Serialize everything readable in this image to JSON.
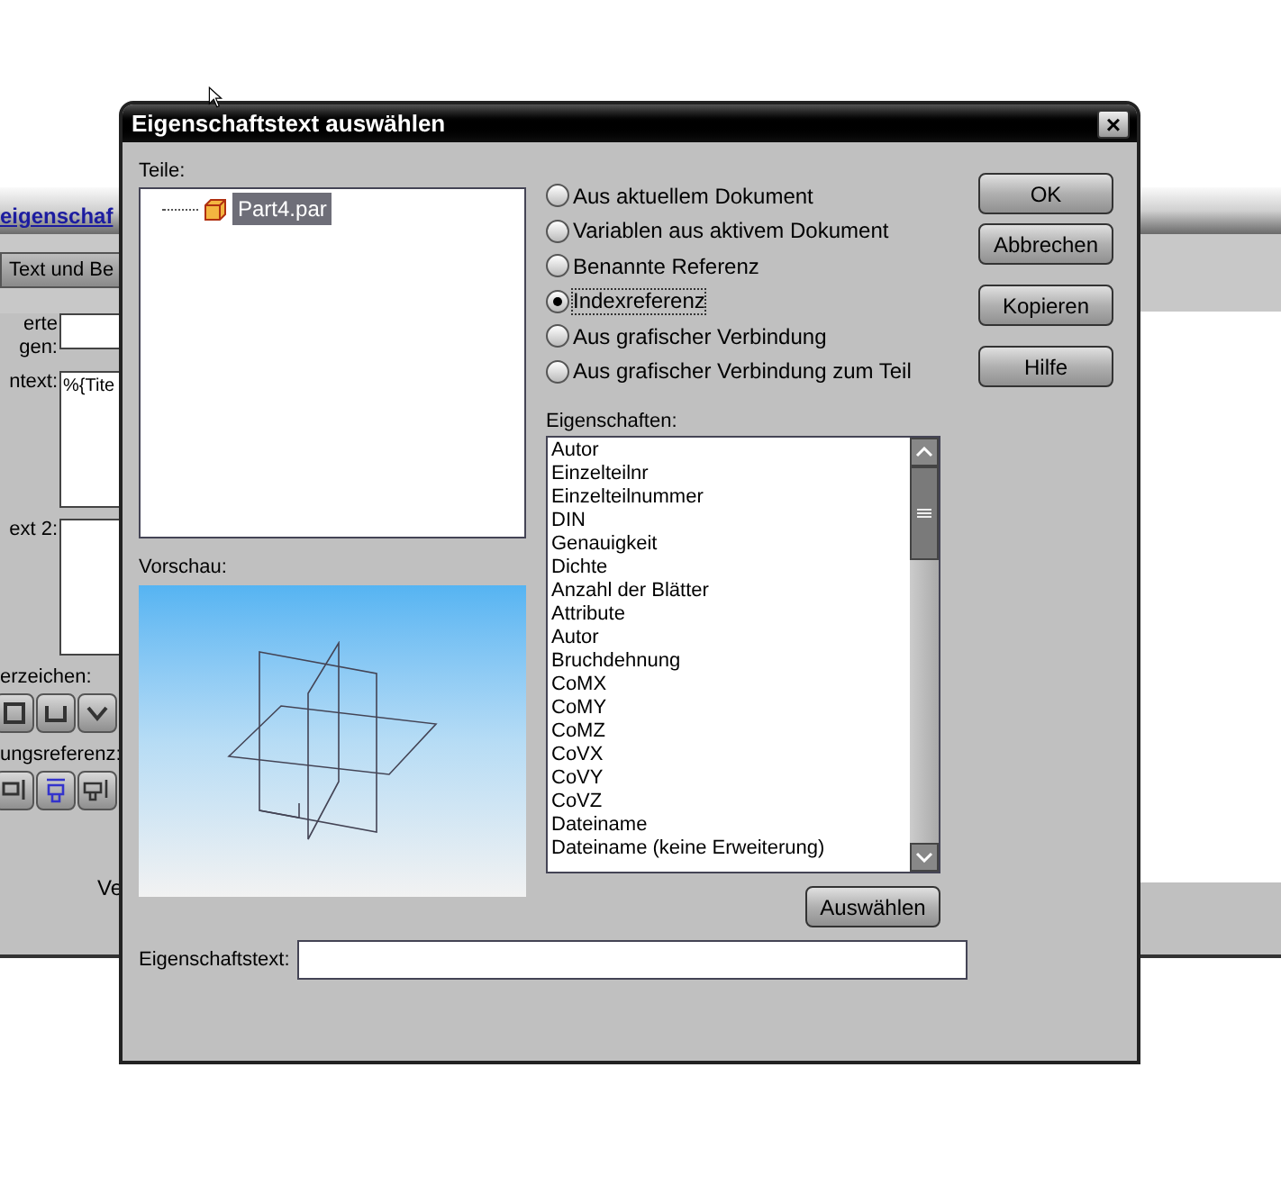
{
  "background_window": {
    "title": "eigenschaf",
    "tab": "Text und Be",
    "fields": [
      {
        "label_lines": [
          "erte",
          "gen:"
        ],
        "kind": "input"
      },
      {
        "label_lines": [
          "ntext:"
        ],
        "kind": "textarea",
        "value": "%{Tite"
      },
      {
        "label_lines": [
          "ext 2:"
        ],
        "kind": "textarea"
      }
    ],
    "groups": [
      {
        "label": "erzeichen:"
      },
      {
        "label": "ungsreferenz:"
      }
    ],
    "footer_text": "Ve"
  },
  "dialog": {
    "title": "Eigenschaftstext auswählen",
    "close": "×",
    "parts_label": "Teile:",
    "tree": [
      {
        "label": "Part4.par",
        "selected": true
      }
    ],
    "preview_label": "Vorschau:",
    "sources": [
      {
        "label": "Aus aktuellem Dokument",
        "selected": false
      },
      {
        "label": "Variablen aus aktivem Dokument",
        "selected": false
      },
      {
        "label": "Benannte Referenz",
        "selected": false
      },
      {
        "label": "Indexreferenz",
        "selected": true
      },
      {
        "label": "Aus grafischer Verbindung",
        "selected": false
      },
      {
        "label": "Aus grafischer Verbindung zum Teil",
        "selected": false
      }
    ],
    "properties_label": "Eigenschaften:",
    "properties": [
      "Autor",
      "Einzelteilnr",
      "Einzelteilnummer",
      "DIN",
      "Genauigkeit",
      "Dichte",
      "Anzahl der Blätter",
      "Attribute",
      "Autor",
      "Bruchdehnung",
      "CoMX",
      "CoMY",
      "CoMZ",
      "CoVX",
      "CoVY",
      "CoVZ",
      "Dateiname",
      "Dateiname (keine Erweiterung)"
    ],
    "select_button": "Auswählen",
    "buttons": [
      "OK",
      "Abbrechen",
      "Kopieren",
      "Hilfe"
    ],
    "property_text_label": "Eigenschaftstext:"
  }
}
